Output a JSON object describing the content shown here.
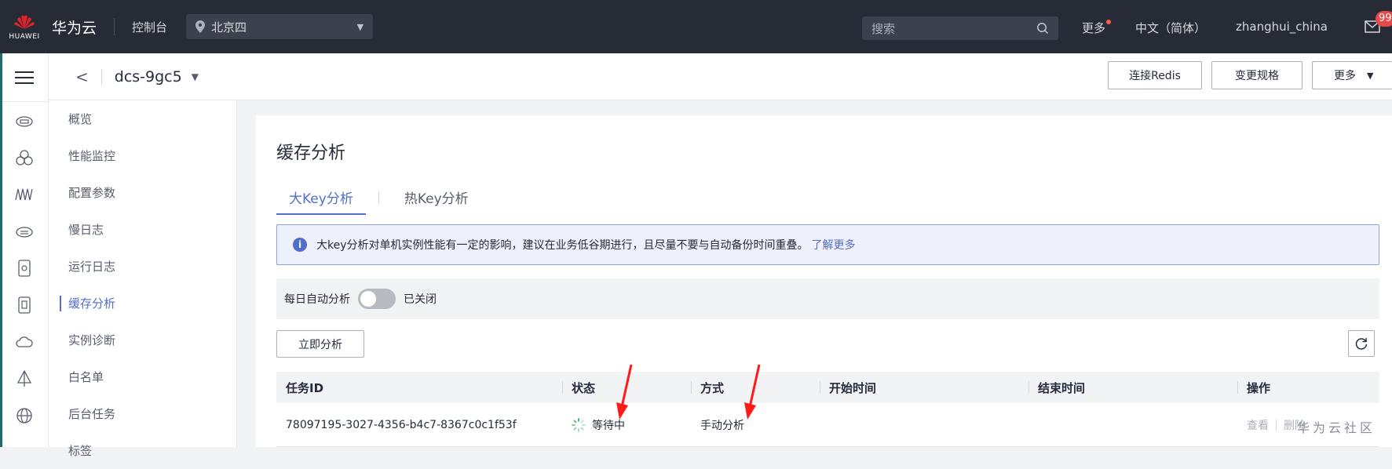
{
  "topbar": {
    "logo_text": "HUAWEI",
    "brand": "华为云",
    "console": "控制台",
    "region": "北京四",
    "search_placeholder": "搜索",
    "more": "更多",
    "language": "中文（简体）",
    "username": "zhanghui_china",
    "mail_badge": "99"
  },
  "rail": {
    "icons": [
      "menu-icon",
      "cloud-server-icon",
      "cluster-icon",
      "monitor-waves-icon",
      "database-cloud-icon",
      "storage-disk-icon",
      "backup-disk-icon",
      "cloud-icon",
      "network-icon",
      "globe-icon"
    ]
  },
  "subheader": {
    "instance_name": "dcs-9gc5",
    "connect_redis": "连接Redis",
    "change_spec": "变更规格",
    "more": "更多"
  },
  "subnav": {
    "items": [
      "概览",
      "性能监控",
      "配置参数",
      "慢日志",
      "运行日志",
      "缓存分析",
      "实例诊断",
      "白名单",
      "后台任务",
      "标签"
    ],
    "active_index": 5
  },
  "main": {
    "title": "缓存分析",
    "tabs": [
      "大Key分析",
      "热Key分析"
    ],
    "active_tab": 0,
    "notice_text": "大key分析对单机实例性能有一定的影响，建议在业务低谷期进行，且尽量不要与自动备份时间重叠。",
    "notice_link": "了解更多",
    "auto_label": "每日自动分析",
    "auto_status": "已关闭",
    "auto_enabled": false,
    "analyze_button": "立即分析",
    "table": {
      "columns": [
        "任务ID",
        "状态",
        "方式",
        "开始时间",
        "结束时间",
        "操作"
      ],
      "rows": [
        {
          "task_id": "78097195-3027-4356-b4c7-8367c0c1f53f",
          "status": "等待中",
          "method": "手动分析",
          "start_time": "",
          "end_time": "",
          "actions": [
            "查看",
            "删除"
          ]
        }
      ]
    }
  },
  "watermark": "华为云社区",
  "colors": {
    "accent": "#526ecc",
    "topbar_bg": "#262b36",
    "annotation_arrow": "#ff1a1a",
    "badge": "#e84a4a"
  }
}
